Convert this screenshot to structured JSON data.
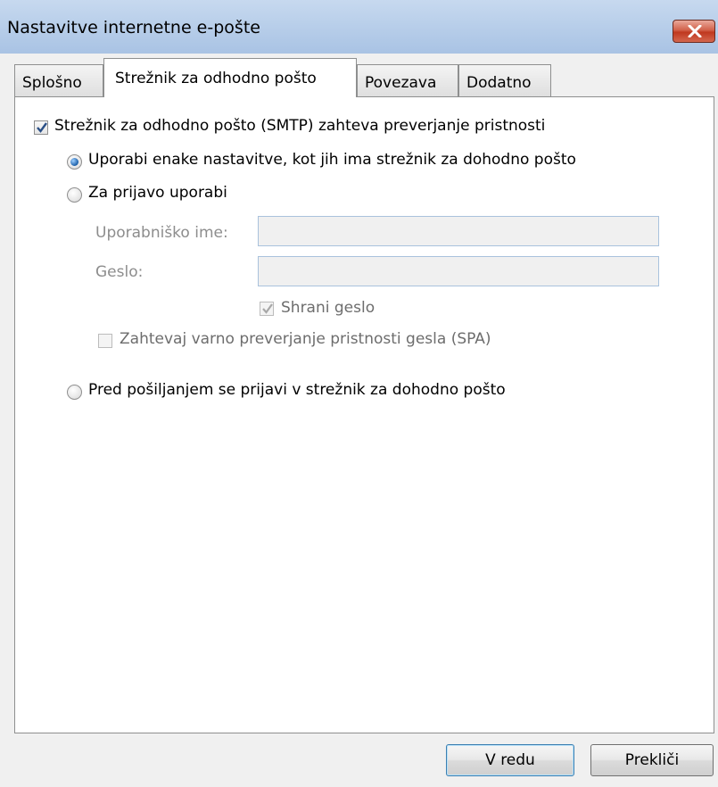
{
  "window": {
    "title": "Nastavitve internetne e-pošte"
  },
  "tabs": [
    {
      "label": "Splošno",
      "active": false
    },
    {
      "label": "Strežnik za odhodno pošto",
      "active": true
    },
    {
      "label": "Povezava",
      "active": false
    },
    {
      "label": "Dodatno",
      "active": false
    }
  ],
  "options": {
    "smtp_auth": {
      "label": "Strežnik za odhodno pošto (SMTP) zahteva preverjanje pristnosti",
      "checked": true
    },
    "use_same": {
      "label": "Uporabi enake nastavitve, kot jih ima strežnik za dohodno pošto",
      "selected": true
    },
    "log_on_using": {
      "label": "Za prijavo uporabi",
      "selected": false
    },
    "username": {
      "label": "Uporabniško ime:",
      "value": ""
    },
    "password": {
      "label": "Geslo:",
      "value": ""
    },
    "remember_password": {
      "label": "Shrani geslo",
      "checked": true,
      "disabled": true
    },
    "spa": {
      "label": "Zahtevaj varno preverjanje pristnosti gesla (SPA)",
      "checked": false,
      "disabled": true
    },
    "log_on_before": {
      "label": "Pred pošiljanjem se prijavi v strežnik za dohodno pošto",
      "selected": false
    }
  },
  "buttons": {
    "ok": "V redu",
    "cancel": "Prekliči"
  },
  "icons": {
    "close": "close-icon",
    "check": "checkmark-icon"
  },
  "colors": {
    "close_button": "#c7432a",
    "title_bar": "#b9cfea",
    "radio_selected": "#1a5ea8"
  }
}
